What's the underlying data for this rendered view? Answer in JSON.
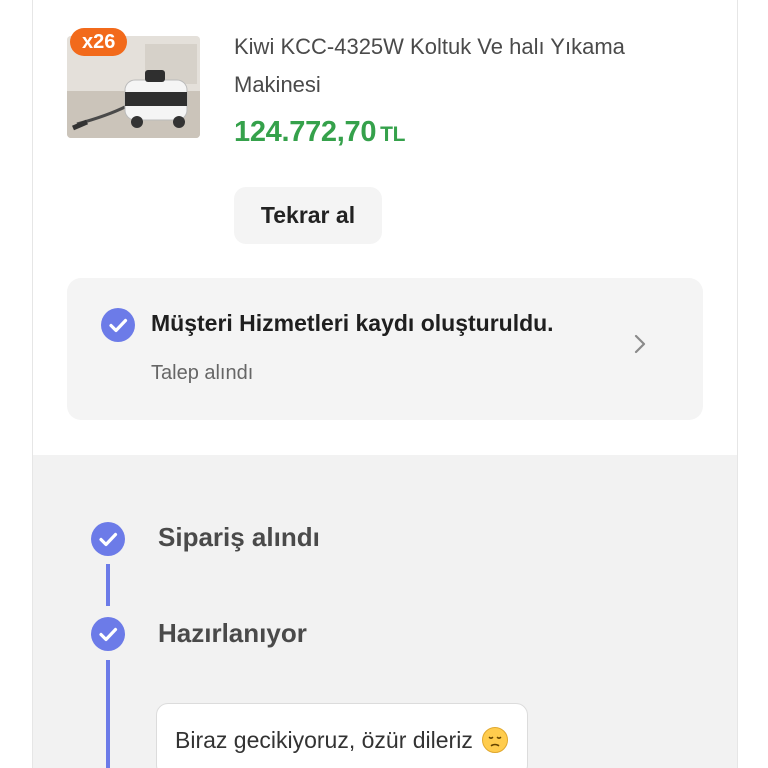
{
  "product": {
    "qty_badge": "x26",
    "title": "Kiwi KCC-4325W Koltuk Ve halı Yıkama Makinesi",
    "price": "124.772,70",
    "currency": "TL",
    "reorder_label": "Tekrar al"
  },
  "service_record": {
    "title": "Müşteri Hizmetleri kaydı oluşturuldu.",
    "subtitle": "Talep alındı",
    "icon": "check-circle-icon",
    "chevron": "chevron-right-icon"
  },
  "timeline": {
    "steps": [
      {
        "label": "Sipariş alındı",
        "done": true
      },
      {
        "label": "Hazırlanıyor",
        "done": true
      }
    ],
    "delay_message": "Biraz gecikiyoruz, özür dileriz",
    "delay_emoji": "sad-face-icon"
  },
  "colors": {
    "accent": "#6c7be8",
    "price": "#35a14b",
    "badge": "#f26a1b"
  }
}
